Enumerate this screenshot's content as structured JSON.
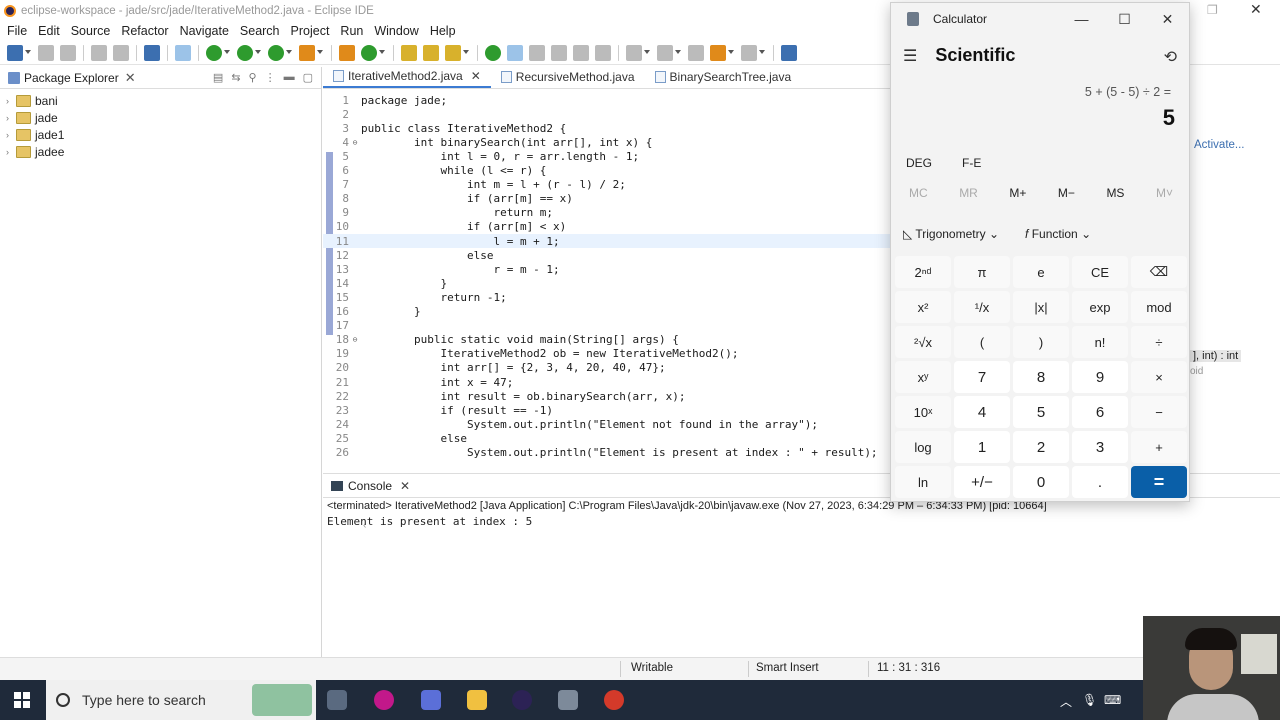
{
  "window": {
    "title": "eclipse-workspace - jade/src/jade/IterativeMethod2.java - Eclipse IDE"
  },
  "menu": [
    "File",
    "Edit",
    "Source",
    "Refactor",
    "Navigate",
    "Search",
    "Project",
    "Run",
    "Window",
    "Help"
  ],
  "package_explorer": {
    "title": "Package Explorer",
    "projects": [
      "bani",
      "jade",
      "jade1",
      "jadee"
    ]
  },
  "editor": {
    "tabs": [
      "IterativeMethod2.java",
      "RecursiveMethod.java",
      "BinarySearchTree.java"
    ],
    "active_tab": 0,
    "highlighted_line": 11,
    "lines": [
      {
        "n": "1",
        "fold": "",
        "text": "package jade;"
      },
      {
        "n": "2",
        "fold": "",
        "text": ""
      },
      {
        "n": "3",
        "fold": "",
        "text": "public class IterativeMethod2 {"
      },
      {
        "n": "4",
        "fold": "⊖",
        "text": "        int binarySearch(int arr[], int x) {"
      },
      {
        "n": "5",
        "fold": "",
        "text": "            int l = 0, r = arr.length - 1;"
      },
      {
        "n": "6",
        "fold": "",
        "text": "            while (l <= r) {"
      },
      {
        "n": "7",
        "fold": "",
        "text": "                int m = l + (r - l) / 2;"
      },
      {
        "n": "8",
        "fold": "",
        "text": "                if (arr[m] == x)"
      },
      {
        "n": "9",
        "fold": "",
        "text": "                    return m;"
      },
      {
        "n": "10",
        "fold": "",
        "text": "                if (arr[m] < x)"
      },
      {
        "n": "11",
        "fold": "",
        "text": "                    l = m + 1;"
      },
      {
        "n": "12",
        "fold": "",
        "text": "                else"
      },
      {
        "n": "13",
        "fold": "",
        "text": "                    r = m - 1;"
      },
      {
        "n": "14",
        "fold": "",
        "text": "            }"
      },
      {
        "n": "15",
        "fold": "",
        "text": "            return -1;"
      },
      {
        "n": "16",
        "fold": "",
        "text": "        }"
      },
      {
        "n": "17",
        "fold": "",
        "text": ""
      },
      {
        "n": "18",
        "fold": "⊖",
        "text": "        public static void main(String[] args) {"
      },
      {
        "n": "19",
        "fold": "",
        "text": "            IterativeMethod2 ob = new IterativeMethod2();"
      },
      {
        "n": "20",
        "fold": "",
        "text": "            int arr[] = {2, 3, 4, 20, 40, 47};"
      },
      {
        "n": "21",
        "fold": "",
        "text": "            int x = 47;"
      },
      {
        "n": "22",
        "fold": "",
        "text": "            int result = ob.binarySearch(arr, x);"
      },
      {
        "n": "23",
        "fold": "",
        "text": "            if (result == -1)"
      },
      {
        "n": "24",
        "fold": "",
        "text": "                System.out.println(\"Element not found in the array\");"
      },
      {
        "n": "25",
        "fold": "",
        "text": "            else"
      },
      {
        "n": "26",
        "fold": "",
        "text": "                System.out.println(\"Element is present at index : \" + result);"
      }
    ]
  },
  "console": {
    "title": "Console",
    "subtitle": "<terminated> IterativeMethod2 [Java Application] C:\\Program Files\\Java\\jdk-20\\bin\\javaw.exe  (Nov 27, 2023, 6:34:29 PM – 6:34:33 PM) [pid: 10664]",
    "output": "Element is present at index : 5"
  },
  "status": {
    "writable": "Writable",
    "insert": "Smart Insert",
    "position": "11 : 31 : 316"
  },
  "right_pane": {
    "activate": "Activate...",
    "signature": "], int) : int",
    "void": "oid"
  },
  "calculator": {
    "title": "Calculator",
    "mode": "Scientific",
    "expression": "5 + (5 - 5) ÷ 2 =",
    "result": "5",
    "angle": [
      "DEG",
      "F-E"
    ],
    "memory": [
      "MC",
      "MR",
      "M+",
      "M−",
      "MS",
      "M˅"
    ],
    "funcs": [
      "Trigonometry",
      "Function"
    ],
    "keys": [
      "2ⁿᵈ",
      "π",
      "e",
      "CE",
      "⌫",
      "x²",
      "¹/x",
      "|x|",
      "exp",
      "mod",
      "²√x",
      "(",
      ")",
      "n!",
      "÷",
      "xʸ",
      "7",
      "8",
      "9",
      "×",
      "10ˣ",
      "4",
      "5",
      "6",
      "−",
      "log",
      "1",
      "2",
      "3",
      "+",
      "ln",
      "+/−",
      "0",
      ".",
      "="
    ]
  },
  "taskbar": {
    "search_placeholder": "Type here to search"
  },
  "colors": {
    "accent": "#0a5fa8",
    "taskbar": "#1f2a3a",
    "highlight_line": "#e8f2fe"
  }
}
